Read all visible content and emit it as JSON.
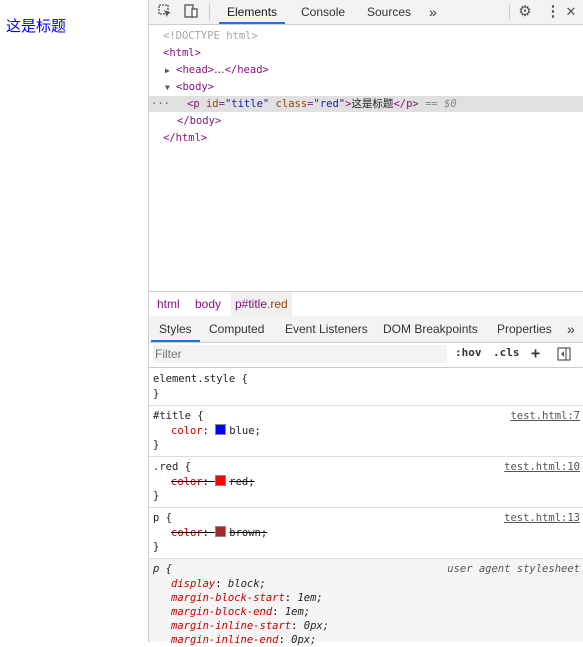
{
  "page": {
    "heading": "这是标题"
  },
  "toolbar": {
    "tabs": [
      "Elements",
      "Console",
      "Sources"
    ],
    "more": "»"
  },
  "dom": {
    "doctype": "<!DOCTYPE html>",
    "html_open": "<html>",
    "head_open": "<head>",
    "head_ellipsis": "…",
    "head_close": "</head>",
    "body_open": "<body>",
    "p_open_lt": "<p",
    "p_attr_id": "id",
    "p_attr_id_val": "\"title\"",
    "p_attr_class": "class",
    "p_attr_class_val": "\"red\"",
    "p_text": "这是标题",
    "p_close": "</p>",
    "selected_marker": "== $0",
    "dots": "···",
    "body_close": "</body>",
    "html_close": "</html>"
  },
  "breadcrumbs": {
    "html": "html",
    "body": "body",
    "p_tag": "p#title",
    "p_class": ".red"
  },
  "subtabs": [
    "Styles",
    "Computed",
    "Event Listeners",
    "DOM Breakpoints",
    "Properties"
  ],
  "subtabs_more": "»",
  "filter": {
    "placeholder": "Filter",
    "hov": ":hov",
    "cls": ".cls",
    "plus": "+"
  },
  "rules": {
    "element_style": {
      "selector": "element.style {",
      "close": "}"
    },
    "title": {
      "selector": "#title {",
      "source": "test.html:7",
      "prop": "color",
      "value": "blue;",
      "swatch": "#0000ff",
      "close": "}"
    },
    "red": {
      "selector": ".red {",
      "source": "test.html:10",
      "prop": "color",
      "value": "red;",
      "swatch": "#ff0000",
      "close": "}"
    },
    "p": {
      "selector": "p {",
      "source": "test.html:13",
      "prop": "color",
      "value": "brown;",
      "swatch": "#a52a2a",
      "close": "}"
    },
    "ua": {
      "selector": "p {",
      "source": "user agent stylesheet",
      "decls": [
        {
          "prop": "display",
          "value": "block;"
        },
        {
          "prop": "margin-block-start",
          "value": "1em;"
        },
        {
          "prop": "margin-block-end",
          "value": "1em;"
        },
        {
          "prop": "margin-inline-start",
          "value": "0px;"
        },
        {
          "prop": "margin-inline-end",
          "value": "0px;"
        }
      ]
    }
  }
}
